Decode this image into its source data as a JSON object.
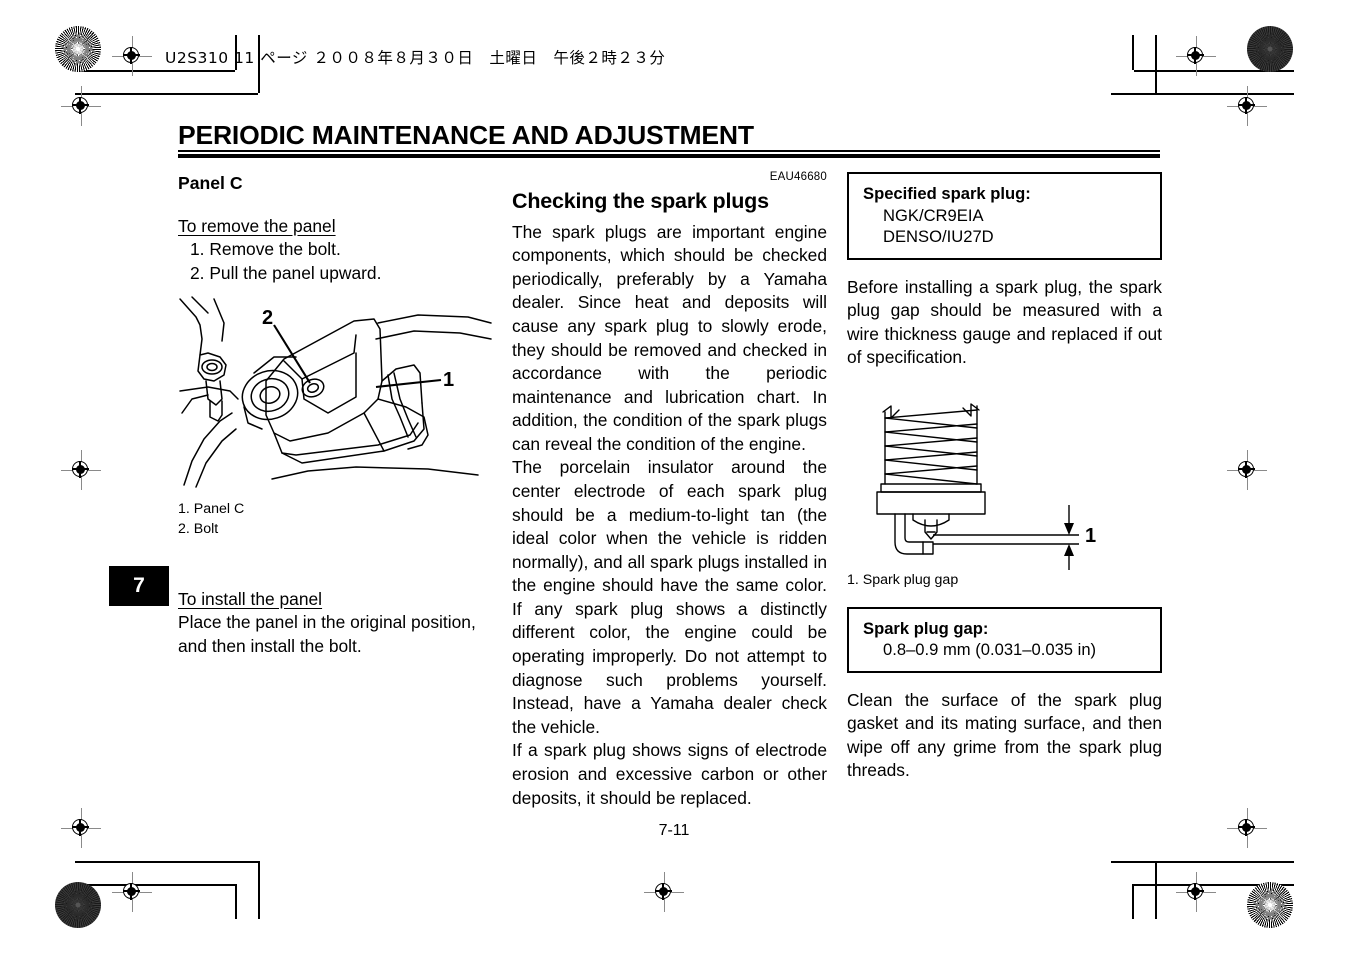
{
  "slug": "U2S310 11 ページ ２００８年８月３０日　土曜日　午後２時２３分",
  "page_title": "PERIODIC MAINTENANCE AND ADJUSTMENT",
  "chapter_tab": "7",
  "folio": "7-11",
  "left_column": {
    "heading": "Panel C",
    "remove_heading": "To remove the panel",
    "steps": [
      "1. Remove the bolt.",
      "2. Pull the panel upward."
    ],
    "figure_callouts": [
      "1",
      "2"
    ],
    "legend": [
      "1. Panel C",
      "2. Bolt"
    ],
    "install_heading": "To install the panel",
    "install_text": "Place the panel in the original position, and then install the bolt."
  },
  "middle_column": {
    "eau_code": "EAU46680",
    "heading": "Checking the spark plugs",
    "paragraphs": [
      "The spark plugs are important engine components, which should be checked periodically, preferably by a Yamaha dealer. Since heat and deposits will cause any spark plug to slowly erode, they should be removed and checked in accordance with the periodic maintenance and lubrication chart. In addition, the condition of the spark plugs can reveal the condition of the engine.",
      "The porcelain insulator around the center electrode of each spark plug should be a medium-to-light tan (the ideal color when the vehicle is ridden normally), and all spark plugs installed in the engine should have the same color. If any spark plug shows a distinctly different color, the engine could be operating improperly. Do not attempt to diagnose such problems yourself. Instead, have a Yamaha dealer check the vehicle.",
      "If a spark plug shows signs of electrode erosion and excessive carbon or other deposits, it should be replaced."
    ]
  },
  "right_column": {
    "spec_plug": {
      "title": "Specified spark plug:",
      "values": [
        "NGK/CR9EIA",
        "DENSO/IU27D"
      ]
    },
    "before_text": "Before installing a spark plug, the spark plug gap should be measured with a wire thickness gauge and replaced if out of specification.",
    "figure_callout": "1",
    "legend": "1. Spark plug gap",
    "spec_gap": {
      "title": "Spark plug gap:",
      "values": [
        "0.8–0.9 mm (0.031–0.035 in)"
      ]
    },
    "clean_text": "Clean the surface of the spark plug gasket and its mating surface, and then wipe off any grime from the spark plug threads."
  }
}
